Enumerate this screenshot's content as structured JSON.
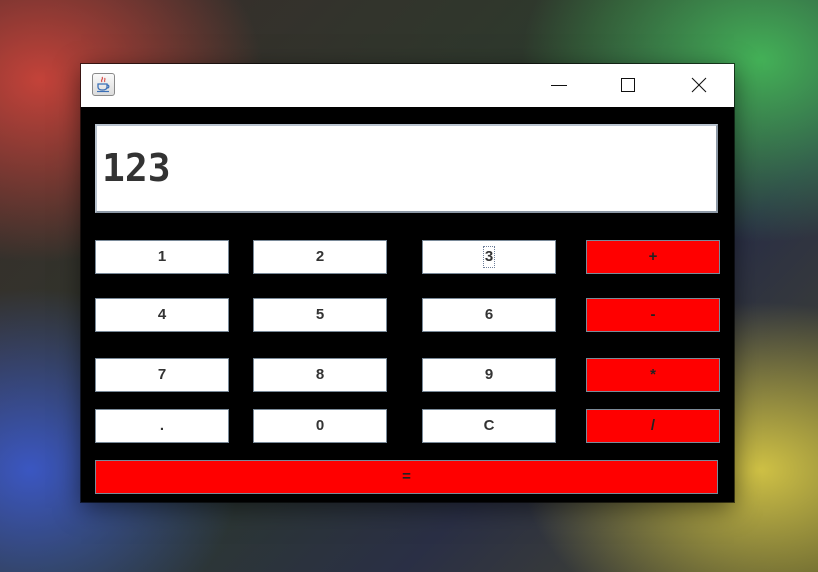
{
  "window": {
    "icon": "java-coffee-cup-icon",
    "controls": {
      "minimize_icon": "minimize-icon",
      "maximize_icon": "maximize-icon",
      "close_icon": "close-icon"
    }
  },
  "display": {
    "value": "123"
  },
  "keys": {
    "k1": "1",
    "k2": "2",
    "k3": "3",
    "plus": "+",
    "k4": "4",
    "k5": "5",
    "k6": "6",
    "minus": "-",
    "k7": "7",
    "k8": "8",
    "k9": "9",
    "multiply": "*",
    "dot": ".",
    "k0": "0",
    "clear": "C",
    "divide": "/",
    "equals": "="
  },
  "colors": {
    "window_background": "#000000",
    "operator_button": "#ff0000",
    "digit_button": "#ffffff",
    "button_text": "#333333"
  }
}
